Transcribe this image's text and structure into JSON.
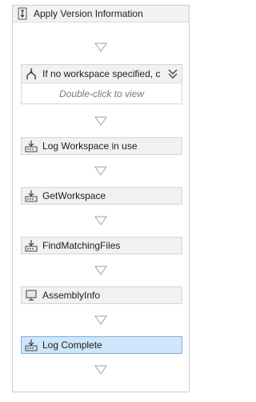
{
  "workflow": {
    "title": "Apply Version Information",
    "icon": "sequence-icon",
    "if_activity": {
      "label": "If no workspace specified, c",
      "hint": "Double-click to view",
      "icon": "if-condition-icon",
      "expand_icon": "double-chevron-down-icon"
    },
    "activities": [
      {
        "label": "Log Workspace in use",
        "icon": "activity-icon",
        "selected": false
      },
      {
        "label": "GetWorkspace",
        "icon": "activity-icon",
        "selected": false
      },
      {
        "label": "FindMatchingFiles",
        "icon": "activity-icon",
        "selected": false
      },
      {
        "label": "AssemblyInfo",
        "icon": "monitor-activity-icon",
        "selected": false
      },
      {
        "label": "Log Complete",
        "icon": "activity-icon",
        "selected": true
      }
    ]
  }
}
